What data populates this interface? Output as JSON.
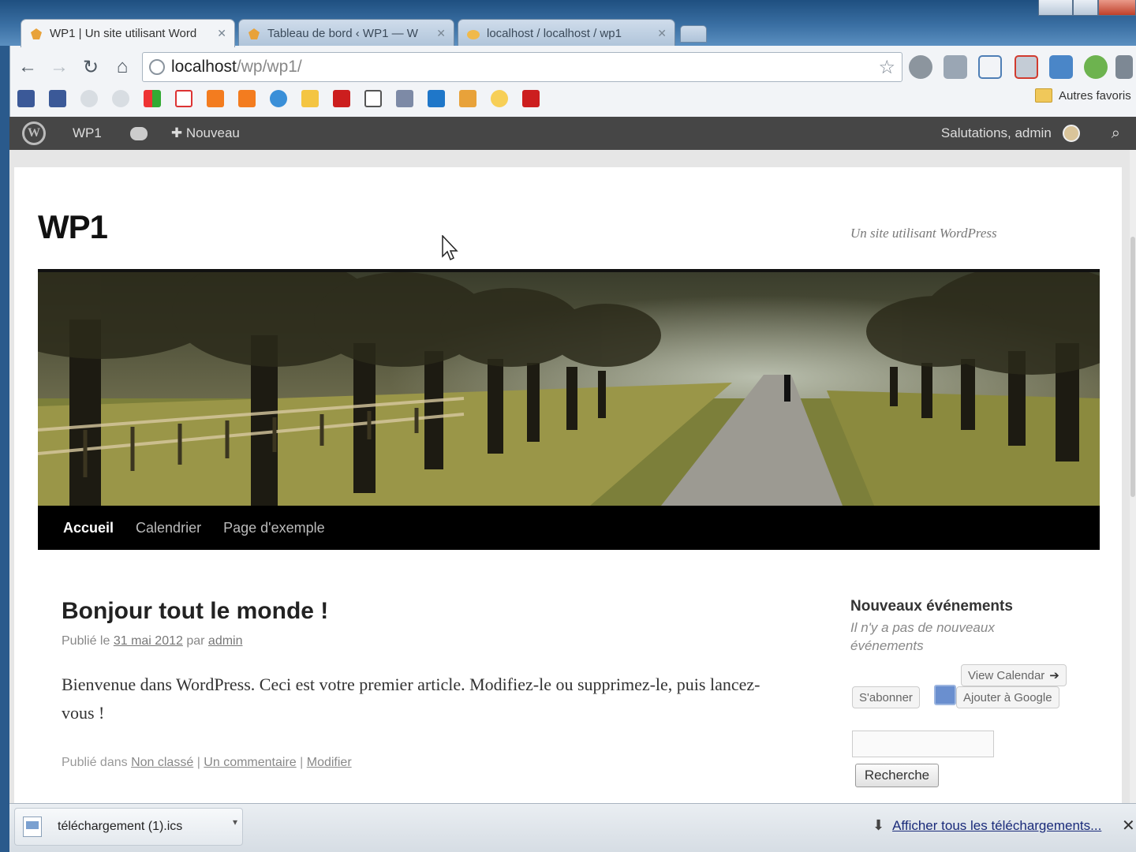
{
  "browser": {
    "tabs": [
      {
        "title": "WP1 | Un site utilisant Word",
        "icon": "wordpress-tab-icon",
        "active": true
      },
      {
        "title": "Tableau de bord ‹ WP1 — W",
        "icon": "wordpress-tab-icon",
        "active": false
      },
      {
        "title": "localhost / localhost / wp1",
        "icon": "phpmyadmin-tab-icon",
        "active": false
      }
    ],
    "address": {
      "host": "localhost",
      "path": "/wp/wp1/"
    },
    "bookmarks_other": "Autres favoris",
    "bookmark_icons": [
      "facebook-icon",
      "facebook-icon",
      "globe-icon",
      "globe-icon",
      "google-icon",
      "gmail-icon",
      "blogger-icon",
      "blogger-icon",
      "chrome-icon",
      "user-icon",
      "youtube-icon",
      "note-icon",
      "document-icon",
      "linkedin-icon",
      "wordpress-icon",
      "sun-icon",
      "youtube-icon"
    ],
    "accent": "#2a5a8c"
  },
  "adminbar": {
    "site": "WP1",
    "new": "Nouveau",
    "greeting": "Salutations, admin"
  },
  "site": {
    "title": "WP1",
    "description": "Un site utilisant WordPress"
  },
  "nav": {
    "items": [
      "Accueil",
      "Calendrier",
      "Page d'exemple"
    ]
  },
  "post": {
    "title": "Bonjour tout le monde !",
    "meta_prefix": "Publié le",
    "date": "31 mai 2012",
    "meta_by": "par",
    "author": "admin",
    "body": "Bienvenue dans WordPress. Ceci est votre premier article. Modifiez-le ou supprimez-le, puis lancez-vous !",
    "foot_prefix": "Publié dans",
    "category": "Non classé",
    "sep": "|",
    "comments": "Un commentaire",
    "edit": "Modifier"
  },
  "widget": {
    "title": "Nouveaux événements",
    "empty": "Il n'y a pas de nouveaux événements",
    "view_calendar": "View Calendar",
    "subscribe": "S'abonner",
    "add_google": "Ajouter à Google",
    "search_button": "Recherche"
  },
  "downloads": {
    "file": "téléchargement (1).ics",
    "show_all": "Afficher tous les téléchargements..."
  }
}
